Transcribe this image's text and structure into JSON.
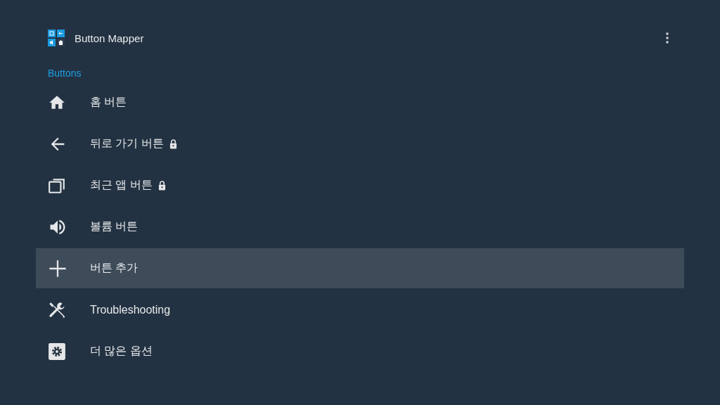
{
  "app": {
    "title": "Button Mapper"
  },
  "section": {
    "title": "Buttons"
  },
  "items": [
    {
      "kind": "home",
      "label": "홈 버튼",
      "locked": false,
      "selected": false
    },
    {
      "kind": "back",
      "label": "뒤로 가기 버튼",
      "locked": true,
      "selected": false
    },
    {
      "kind": "recents",
      "label": "최근 앱 버튼",
      "locked": true,
      "selected": false
    },
    {
      "kind": "volume",
      "label": "볼륨 버튼",
      "locked": false,
      "selected": false
    },
    {
      "kind": "add",
      "label": "버튼 추가",
      "locked": false,
      "selected": true
    },
    {
      "kind": "tools",
      "label": "Troubleshooting",
      "locked": false,
      "selected": false
    },
    {
      "kind": "settings",
      "label": "더 많은 옵션",
      "locked": false,
      "selected": false
    }
  ]
}
